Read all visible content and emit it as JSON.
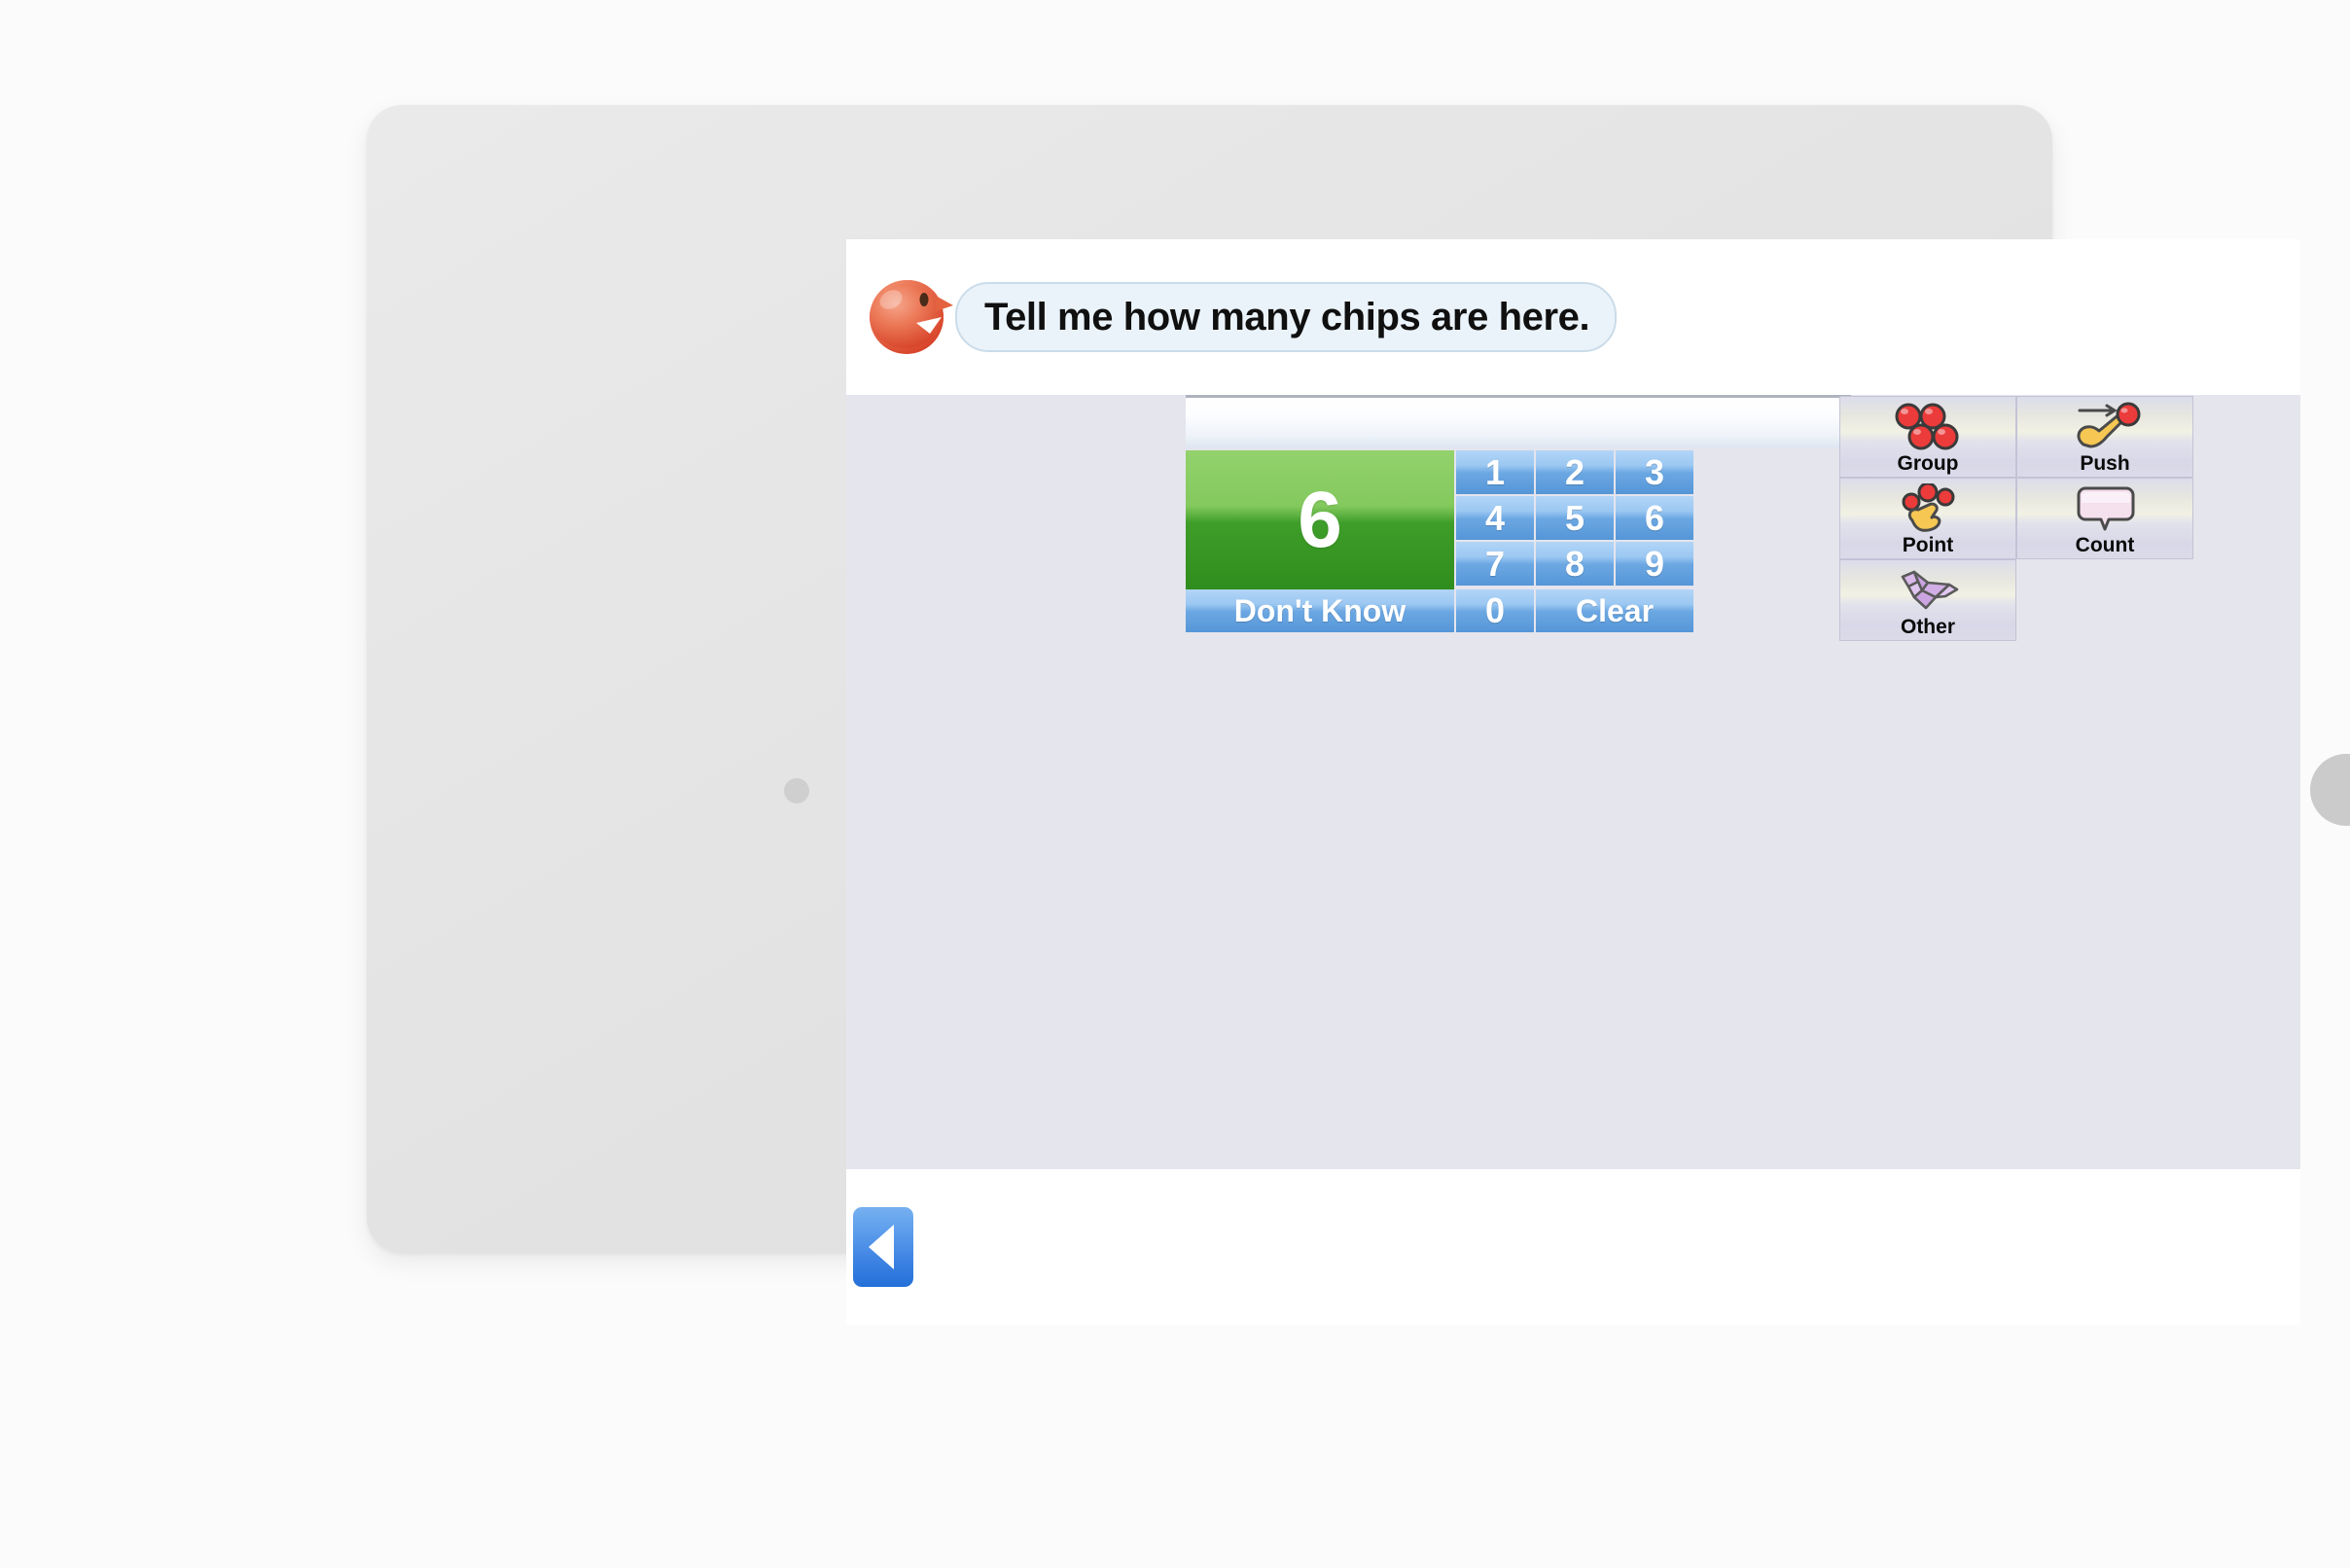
{
  "device": {
    "type": "tablet",
    "camera_icon": "camera-dot-icon",
    "home_button_icon": "home-button-icon"
  },
  "header": {
    "avatar_icon": "bird-avatar-icon",
    "prompt_text": "Tell me how many chips are here."
  },
  "entry": {
    "answer_display_value": "",
    "result_value": "6",
    "keys": [
      {
        "id": "key-1",
        "label": "1",
        "type": "digit"
      },
      {
        "id": "key-2",
        "label": "2",
        "type": "digit"
      },
      {
        "id": "key-3",
        "label": "3",
        "type": "digit"
      },
      {
        "id": "key-4",
        "label": "4",
        "type": "digit"
      },
      {
        "id": "key-5",
        "label": "5",
        "type": "digit"
      },
      {
        "id": "key-6",
        "label": "6",
        "type": "digit"
      },
      {
        "id": "key-7",
        "label": "7",
        "type": "digit"
      },
      {
        "id": "key-8",
        "label": "8",
        "type": "digit"
      },
      {
        "id": "key-9",
        "label": "9",
        "type": "digit"
      },
      {
        "id": "key-0",
        "label": "0",
        "type": "digit"
      }
    ],
    "dont_know_label": "Don't Know",
    "clear_label": "Clear"
  },
  "actions": [
    {
      "id": "group",
      "label": "Group",
      "icon": "four-red-chips-icon"
    },
    {
      "id": "push",
      "label": "Push",
      "icon": "hand-push-chip-icon"
    },
    {
      "id": "point",
      "label": "Point",
      "icon": "hand-point-chips-icon"
    },
    {
      "id": "count",
      "label": "Count",
      "icon": "speech-bubble-icon"
    },
    {
      "id": "other",
      "label": "Other",
      "icon": "origami-bird-icon"
    }
  ],
  "footer": {
    "back_label": "",
    "back_icon": "back-arrow-icon"
  },
  "colors": {
    "bezel": "#e4e4e4",
    "canvas": "#e5e5ed",
    "key_blue_light": "#b2d5f7",
    "key_blue_dark": "#5596d8",
    "result_green_light": "#93d26d",
    "result_green_dark": "#2f8d1d",
    "bubble_fill": "#ebf3fa",
    "bubble_border": "#cadcea",
    "chip_red": "#ec3b3b",
    "hand_yellow": "#f6c752",
    "origami_purple": "#d7b6e8",
    "back_blue": "#3d82e3"
  }
}
